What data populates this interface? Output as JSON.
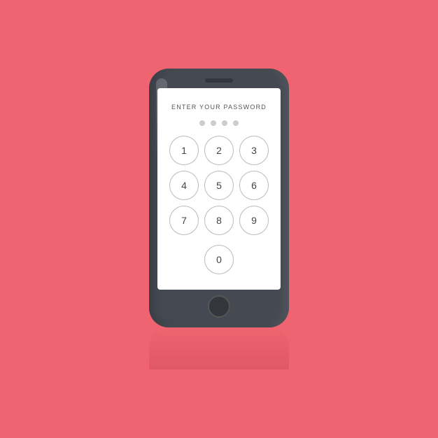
{
  "background_color": "#f06370",
  "phone": {
    "color": "#454a52"
  },
  "screen": {
    "title": "ENTER YOUR PASSWORD",
    "dots_count": 4,
    "keypad": {
      "keys": [
        "1",
        "2",
        "3",
        "4",
        "5",
        "6",
        "7",
        "8",
        "9",
        "0"
      ]
    }
  }
}
